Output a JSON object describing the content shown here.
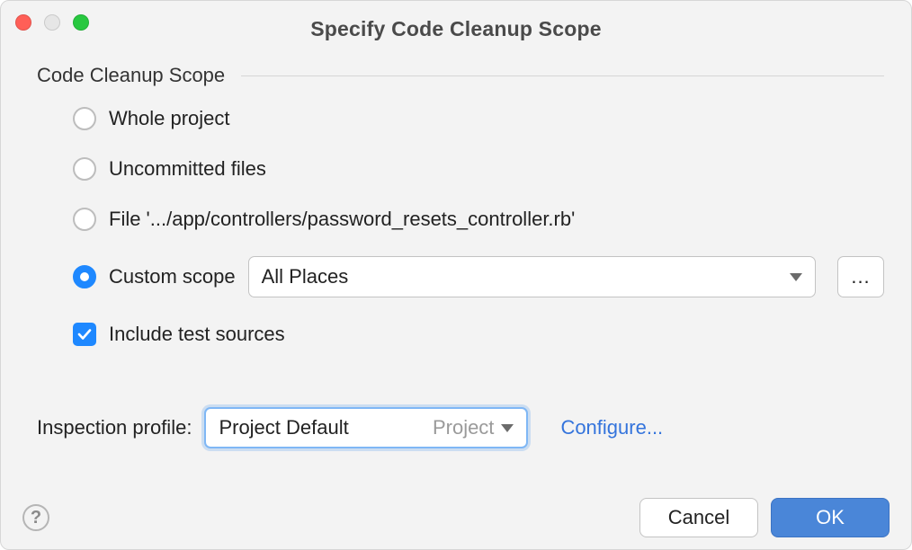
{
  "title": "Specify Code Cleanup Scope",
  "group_label": "Code Cleanup Scope",
  "options": {
    "whole_project": "Whole project",
    "uncommitted_files": "Uncommitted files",
    "file": "File '.../app/controllers/password_resets_controller.rb'",
    "custom_scope": "Custom scope",
    "include_tests": "Include test sources",
    "selected": "custom_scope",
    "include_tests_checked": true
  },
  "custom_scope_combo": {
    "value": "All Places"
  },
  "more_label": "...",
  "inspection": {
    "label": "Inspection profile:",
    "value": "Project Default",
    "sub": "Project"
  },
  "configure_label": "Configure...",
  "buttons": {
    "cancel": "Cancel",
    "ok": "OK"
  },
  "help_glyph": "?"
}
